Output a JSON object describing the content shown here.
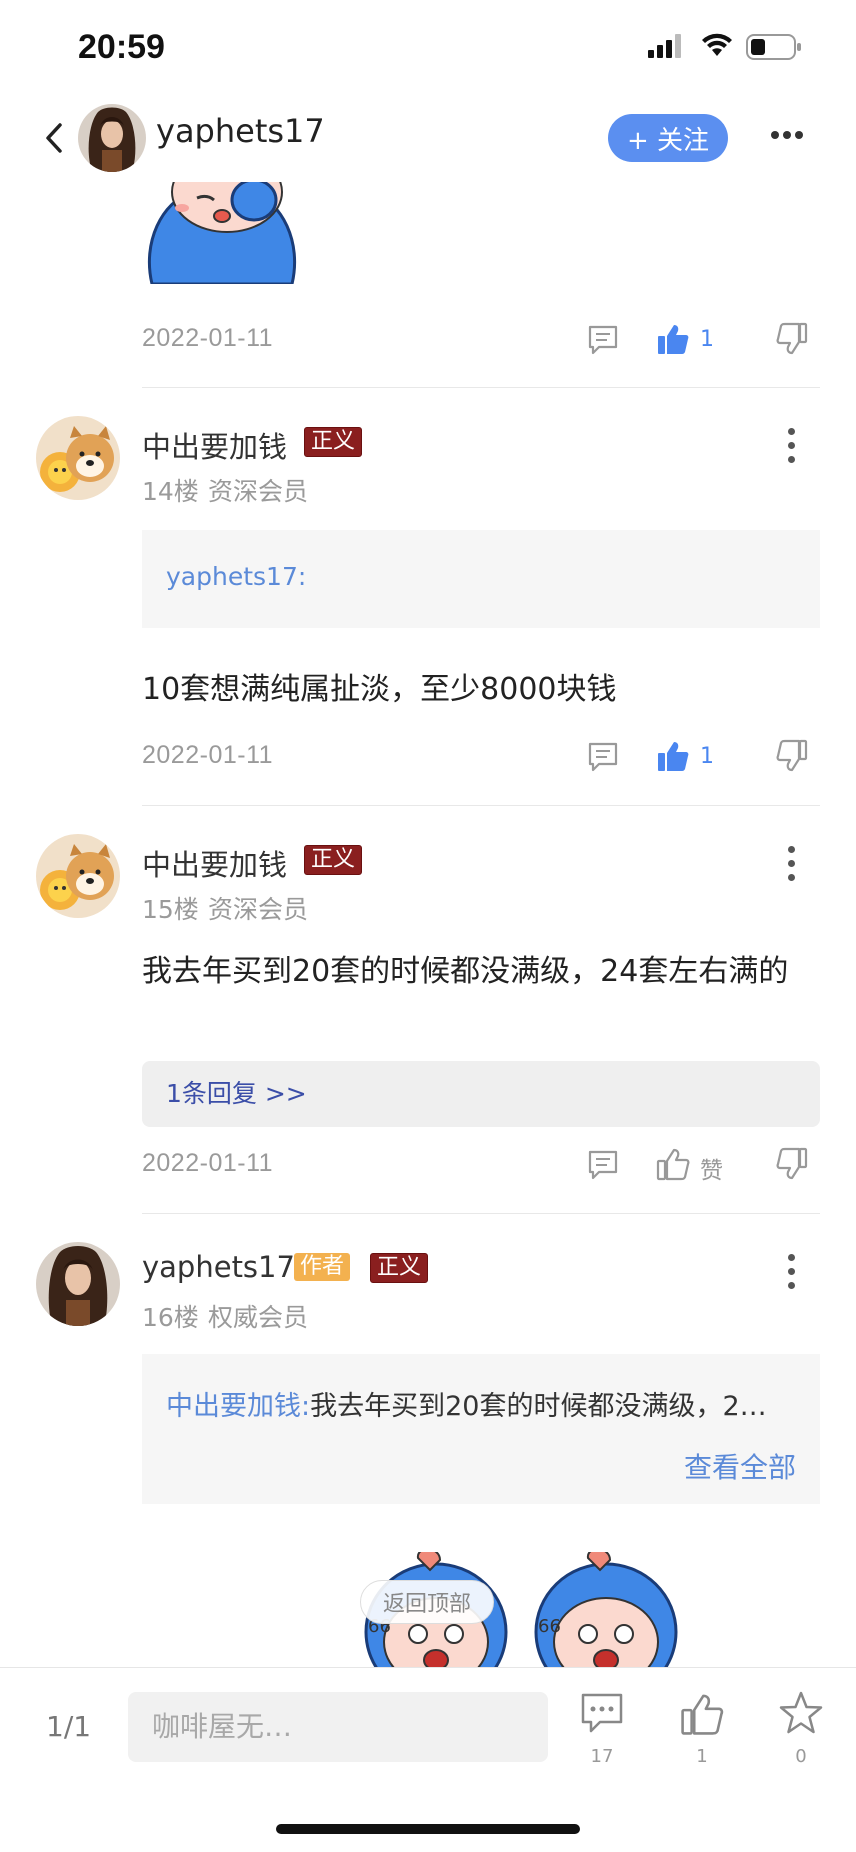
{
  "status_bar": {
    "time": "20:59"
  },
  "header": {
    "username": "yaphets17",
    "follow_label": "+ 关注"
  },
  "posts": [
    {
      "date": "2022-01-11",
      "like_count": "1"
    },
    {
      "author": "中出要加钱",
      "badge": "正义",
      "floor": "14楼",
      "rank": "资深会员",
      "quote_author": "yaphets17:",
      "text": "10套想满纯属扯淡，至少8000块钱",
      "date": "2022-01-11",
      "like_count": "1"
    },
    {
      "author": "中出要加钱",
      "badge": "正义",
      "floor": "15楼",
      "rank": "资深会员",
      "text": "我去年买到20套的时候都没满级，24套左右满的",
      "reply_link": "1条回复 >>",
      "date": "2022-01-11",
      "like_label": "赞"
    },
    {
      "author": "yaphets17",
      "author_tag": "作者",
      "badge": "正义",
      "floor": "16楼",
      "rank": "权威会员",
      "quote_author": "中出要加钱:",
      "quote_text": "我去年买到20套的时候都没满级，2…",
      "view_all": "查看全部"
    }
  ],
  "back_to_top": "返回顶部",
  "bottom_bar": {
    "page": "1/1",
    "input_placeholder": "咖啡屋无…",
    "comment_count": "17",
    "like_count": "1",
    "star_count": "0"
  },
  "colors": {
    "accent": "#5b8ff0",
    "badge_red": "#8a1f1f",
    "badge_orange": "#f3b14f",
    "link_blue": "#5b8ad8"
  },
  "icons": [
    "back-arrow-icon",
    "more-icon",
    "comment-icon",
    "thumbs-up-icon",
    "thumbs-down-icon",
    "kebab-icon",
    "star-icon"
  ]
}
